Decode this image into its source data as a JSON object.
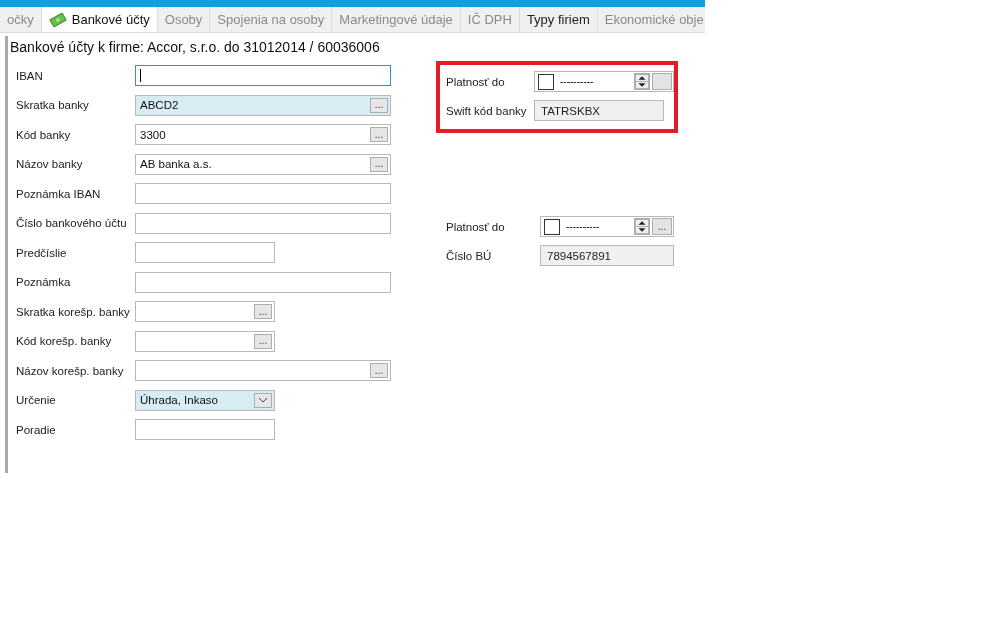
{
  "tabs": [
    {
      "label": "očky",
      "selected": false,
      "hovered": false,
      "icon": false
    },
    {
      "label": "Bankové účty",
      "selected": true,
      "hovered": false,
      "icon": true
    },
    {
      "label": "Osoby",
      "selected": false,
      "hovered": false,
      "icon": false
    },
    {
      "label": "Spojenia na osoby",
      "selected": false,
      "hovered": false,
      "icon": false
    },
    {
      "label": "Marketingové údaje",
      "selected": false,
      "hovered": false,
      "icon": false
    },
    {
      "label": "IČ DPH",
      "selected": false,
      "hovered": false,
      "icon": false
    },
    {
      "label": "Typy firiem",
      "selected": false,
      "hovered": true,
      "icon": false
    },
    {
      "label": "Ekonomické obje",
      "selected": false,
      "hovered": false,
      "icon": false
    }
  ],
  "title": "Bankové účty k firme: Accor, s.r.o. do 31012014 / 60036006",
  "left_fields": [
    {
      "label": "IBAN",
      "kind": "text",
      "wide": true,
      "focused": true,
      "highlighted": false
    },
    {
      "label": "Skratka banky",
      "kind": "lookup",
      "wide": true,
      "value": "ABCD2",
      "button": "...",
      "focused": false,
      "highlighted": true
    },
    {
      "label": "Kód banky",
      "kind": "lookup",
      "wide": true,
      "value": "3300",
      "button": "...",
      "focused": false,
      "highlighted": false
    },
    {
      "label": "Názov banky",
      "kind": "lookup",
      "wide": true,
      "value": "AB banka a.s.",
      "button": "...",
      "focused": false,
      "highlighted": false
    },
    {
      "label": "Poznámka IBAN",
      "kind": "text",
      "wide": true,
      "focused": false,
      "highlighted": false
    },
    {
      "label": "Číslo bankového účtu",
      "kind": "text",
      "wide": true,
      "focused": false,
      "highlighted": false
    },
    {
      "label": "Predčíslie",
      "kind": "text",
      "wide": false,
      "focused": false,
      "highlighted": false
    },
    {
      "label": "Poznámka",
      "kind": "text",
      "wide": true,
      "focused": false,
      "highlighted": false
    },
    {
      "label": "Skratka korešp. banky",
      "kind": "lookup",
      "wide": false,
      "button": "...",
      "focused": false,
      "highlighted": false
    },
    {
      "label": "Kód korešp. banky",
      "kind": "lookup",
      "wide": false,
      "button": "...",
      "focused": false,
      "highlighted": false
    },
    {
      "label": "Názov korešp. banky",
      "kind": "lookup",
      "wide": true,
      "button": "...",
      "focused": false,
      "highlighted": false
    },
    {
      "label": "Určenie",
      "kind": "combo",
      "wide": false,
      "value": "Úhrada, Inkaso",
      "focused": false,
      "highlighted": true
    },
    {
      "label": "Poradie",
      "kind": "text",
      "wide": false,
      "focused": false,
      "highlighted": false
    }
  ],
  "right_groups": [
    {
      "marked": true,
      "fields": [
        {
          "label": "Platnosť do",
          "kind": "date",
          "value": "----------",
          "checked": false
        },
        {
          "label": "Swift kód banky",
          "kind": "readonly",
          "value": "TATRSKBX"
        }
      ]
    },
    {
      "marked": false,
      "fields": [
        {
          "label": "Platnosť do",
          "kind": "date",
          "value": "----------",
          "checked": false,
          "button": "..."
        },
        {
          "label": "Číslo BÚ",
          "kind": "readonly",
          "value": "7894567891"
        }
      ]
    }
  ]
}
